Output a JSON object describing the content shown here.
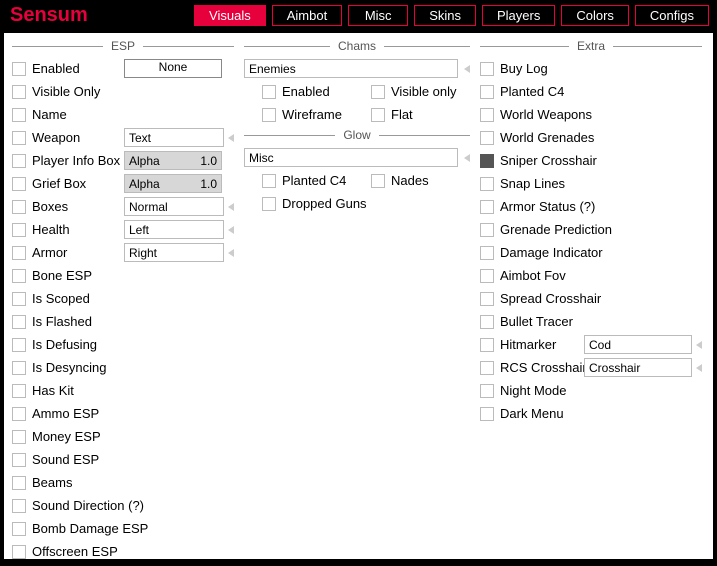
{
  "brand": "Sensum",
  "tabs": [
    "Visuals",
    "Aimbot",
    "Misc",
    "Skins",
    "Players",
    "Colors",
    "Configs"
  ],
  "activeTab": 0,
  "esp": {
    "title": "ESP",
    "keybind": "None",
    "alpha_lbl": "Alpha",
    "alpha_val": "1.0",
    "weapon_combo": "Text",
    "boxes_combo": "Normal",
    "health_combo": "Left",
    "armor_combo": "Right",
    "items": [
      "Enabled",
      "Visible Only",
      "Name",
      "Weapon",
      "Player Info Box",
      "Grief Box",
      "Boxes",
      "Health",
      "Armor",
      "Bone ESP",
      "Is Scoped",
      "Is Flashed",
      "Is Defusing",
      "Is Desyncing",
      "Has Kit",
      "Ammo ESP",
      "Money ESP",
      "Sound ESP",
      "Beams",
      "Sound Direction (?)",
      "Bomb Damage ESP",
      "Offscreen ESP"
    ]
  },
  "chams": {
    "title": "Chams",
    "combo": "Enemies",
    "opts": [
      "Enabled",
      "Visible only",
      "Wireframe",
      "Flat"
    ]
  },
  "glow": {
    "title": "Glow",
    "combo": "Misc",
    "opts": [
      "Planted C4",
      "Nades",
      "Dropped Guns"
    ]
  },
  "extra": {
    "title": "Extra",
    "hitmarker_combo": "Cod",
    "rcs_combo": "Crosshair",
    "hitmarker_lbl": "Hitmarker",
    "rcs_lbl": "RCS Crosshair",
    "items": [
      "Buy Log",
      "Planted C4",
      "World Weapons",
      "World Grenades",
      "Sniper Crosshair",
      "Snap Lines",
      "Armor Status (?)",
      "Grenade Prediction",
      "Damage Indicator",
      "Aimbot Fov",
      "Spread Crosshair",
      "Bullet Tracer",
      "Hitmarker",
      "RCS Crosshair",
      "Night Mode",
      "Dark Menu"
    ]
  }
}
